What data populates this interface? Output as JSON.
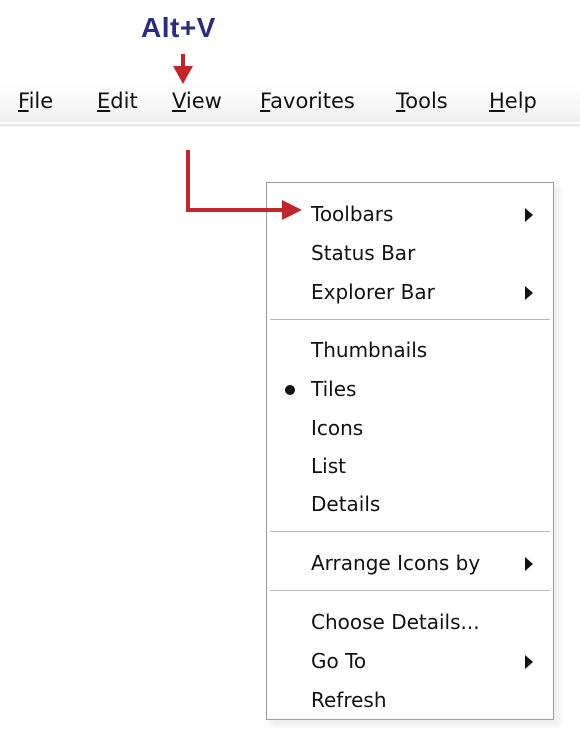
{
  "callout": {
    "text": "Alt+V",
    "color": "#2c2c7c"
  },
  "arrow_color": "#c0272d",
  "menubar": {
    "items": [
      {
        "label_mnemonic": "F",
        "label_rest": "ile"
      },
      {
        "label_mnemonic": "E",
        "label_rest": "dit"
      },
      {
        "label_mnemonic": "V",
        "label_rest": "iew"
      },
      {
        "label_mnemonic": "F",
        "label_rest": "avorites"
      },
      {
        "label_mnemonic": "T",
        "label_rest": "ools"
      },
      {
        "label_mnemonic": "H",
        "label_rest": "elp"
      }
    ]
  },
  "view_menu": {
    "groups": [
      {
        "items": [
          {
            "label": "Toolbars",
            "has_submenu": true,
            "icon": "submenu-arrow-icon"
          },
          {
            "label": "Status Bar"
          },
          {
            "label": "Explorer Bar",
            "has_submenu": true,
            "icon": "submenu-arrow-icon"
          }
        ]
      },
      {
        "items": [
          {
            "label": "Thumbnails"
          },
          {
            "label": "Tiles",
            "selected": true,
            "icon": "radio-bullet-icon"
          },
          {
            "label": "Icons"
          },
          {
            "label": "List"
          },
          {
            "label": "Details"
          }
        ]
      },
      {
        "items": [
          {
            "label": "Arrange Icons by",
            "has_submenu": true,
            "icon": "submenu-arrow-icon"
          }
        ]
      },
      {
        "items": [
          {
            "label": "Choose Details..."
          },
          {
            "label": "Go To",
            "has_submenu": true,
            "icon": "submenu-arrow-icon"
          },
          {
            "label": "Refresh"
          }
        ]
      }
    ]
  }
}
